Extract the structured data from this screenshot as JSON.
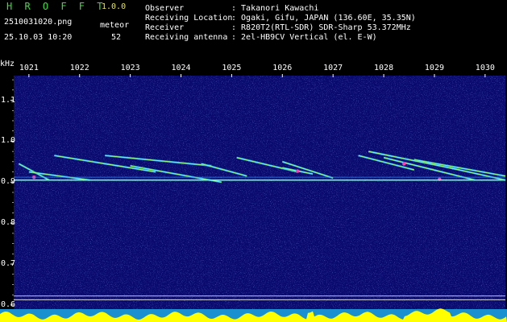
{
  "header": {
    "app_title": "H R O F F T",
    "app_version": "1.0.0",
    "filename": "2510031020.png",
    "datetime": "25.10.03 10:20",
    "meteor_label": "meteor",
    "meteor_count": "52",
    "info": [
      {
        "label": "Observer",
        "value": ": Takanori Kawachi"
      },
      {
        "label": "Receiving Location",
        "value": ": Ogaki, Gifu, JAPAN (136.60E, 35.35N)"
      },
      {
        "label": "Receiver",
        "value": ": R820T2(RTL-SDR) SDR-Sharp 53.372MHz"
      },
      {
        "label": "Receiving antenna",
        "value": ": 2el-HB9CV Vertical (el. E-W)"
      }
    ]
  },
  "colors": {
    "background": "#000000",
    "spectrogram_bg": "#0a0a6e",
    "title_green": "#3fdc3f",
    "version_yellow": "#e6e64a",
    "level_bar": "#ffff00",
    "grid_line": "#ffffff"
  },
  "chart_data": {
    "type": "heatmap",
    "y_unit": "kHz",
    "x_ticks": [
      "1021",
      "1022",
      "1023",
      "1024",
      "1025",
      "1026",
      "1027",
      "1028",
      "1029",
      "1030"
    ],
    "y_ticks": [
      "1.1",
      "1.0",
      "0.9",
      "0.8",
      "0.7",
      "0.6"
    ],
    "x_range": [
      1020.7,
      1030.4
    ],
    "y_range": [
      0.59,
      1.16
    ],
    "carrier_khz": 0.905,
    "carrier2_khz": 0.912,
    "reference_lines_khz": [
      0.622,
      0.613
    ],
    "meteor_streaks": [
      {
        "x": [
          1020.8,
          1021.4
        ],
        "y": [
          0.945,
          0.905
        ]
      },
      {
        "x": [
          1021.0,
          1022.2
        ],
        "y": [
          0.925,
          0.905
        ]
      },
      {
        "x": [
          1021.5,
          1023.5
        ],
        "y": [
          0.965,
          0.925
        ]
      },
      {
        "x": [
          1022.5,
          1024.6
        ],
        "y": [
          0.965,
          0.94
        ]
      },
      {
        "x": [
          1023.0,
          1024.8
        ],
        "y": [
          0.94,
          0.9
        ]
      },
      {
        "x": [
          1024.4,
          1025.3
        ],
        "y": [
          0.945,
          0.915
        ]
      },
      {
        "x": [
          1025.1,
          1026.3
        ],
        "y": [
          0.96,
          0.925
        ]
      },
      {
        "x": [
          1026.0,
          1027.0
        ],
        "y": [
          0.95,
          0.91
        ]
      },
      {
        "x": [
          1026.0,
          1026.6
        ],
        "y": [
          0.935,
          0.92
        ]
      },
      {
        "x": [
          1027.5,
          1028.6
        ],
        "y": [
          0.965,
          0.93
        ]
      },
      {
        "x": [
          1027.7,
          1029.5
        ],
        "y": [
          0.975,
          0.93
        ]
      },
      {
        "x": [
          1028.0,
          1029.8
        ],
        "y": [
          0.96,
          0.905
        ]
      },
      {
        "x": [
          1028.6,
          1030.4
        ],
        "y": [
          0.955,
          0.915
        ]
      },
      {
        "x": [
          1029.3,
          1030.4
        ],
        "y": [
          0.935,
          0.905
        ]
      }
    ],
    "grid": false,
    "legend": "none"
  }
}
